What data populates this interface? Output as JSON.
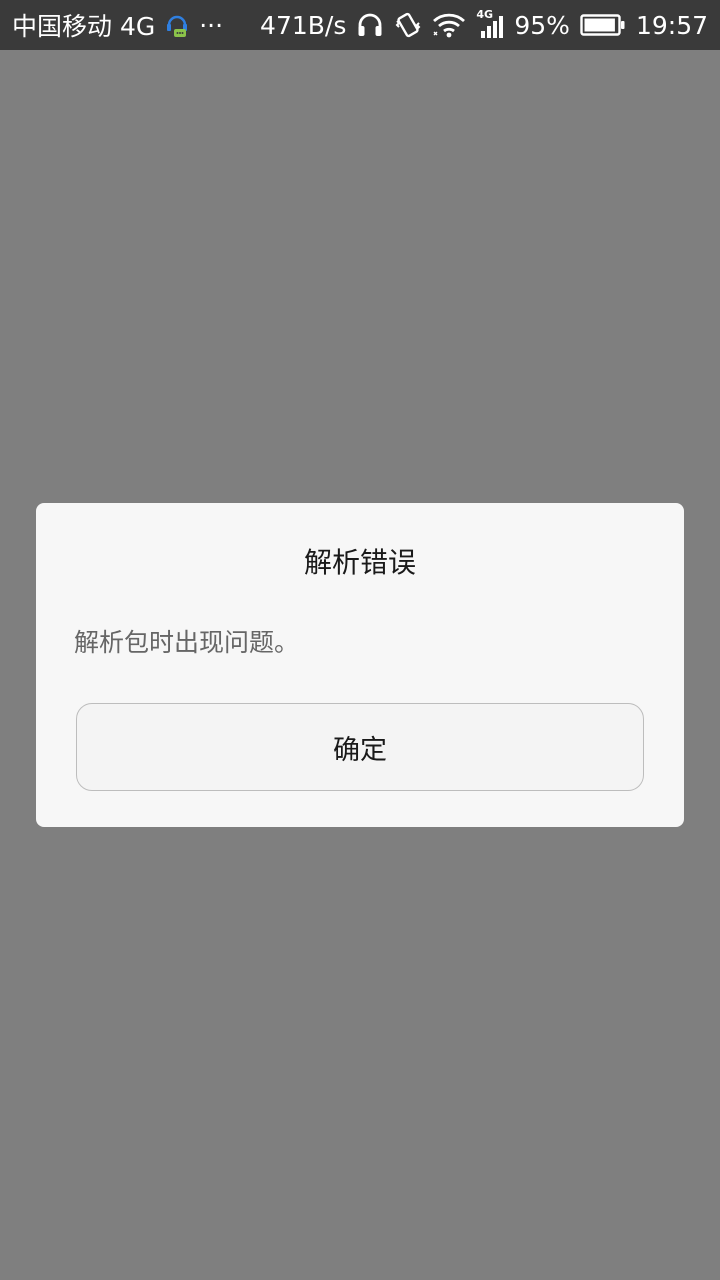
{
  "status_bar": {
    "carrier": "中国移动 4G",
    "more": "···",
    "network_speed": "471B/s",
    "signal_tag": "4G",
    "battery_percent": "95%",
    "battery_level": 0.95,
    "time": "19:57",
    "icons": [
      "assistant-icon",
      "headphones-icon",
      "vibrate-icon",
      "wifi-icon",
      "cell-signal-icon",
      "battery-icon"
    ]
  },
  "dialog": {
    "title": "解析错误",
    "message": "解析包时出现问题。",
    "ok_label": "确定"
  },
  "colors": {
    "background_dim": "#7f7f7f",
    "status_bar": "#3a3a3a",
    "dialog_bg": "#f7f7f7",
    "button_border": "#bdbdbd"
  }
}
